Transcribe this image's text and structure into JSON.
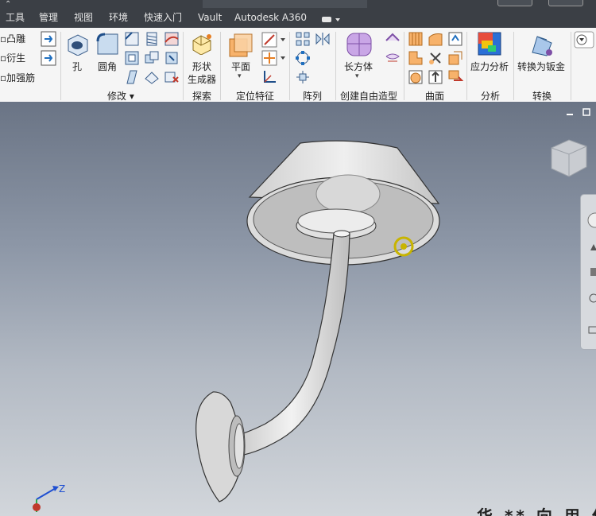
{
  "menu": {
    "tabs": [
      "工具",
      "管理",
      "视图",
      "环境",
      "快速入门",
      "Vault",
      "Autodesk A360"
    ]
  },
  "ribbon": {
    "left_items": [
      "凸雕",
      "衍生",
      "加强筋"
    ],
    "modify": {
      "hole": "孔",
      "fillet": "圆角",
      "label": "修改"
    },
    "explore": {
      "shape_gen_1": "形状",
      "shape_gen_2": "生成器",
      "label": "探索"
    },
    "work_features": {
      "plane": "平面",
      "label": "定位特征"
    },
    "pattern": {
      "label": "阵列"
    },
    "freeform": {
      "box": "长方体",
      "label": "创建自由造型"
    },
    "surface": {
      "label": "曲面"
    },
    "analysis": {
      "stress": "应力分析",
      "label": "分析"
    },
    "convert": {
      "to_sheet_metal": "转换为钣金",
      "label": "转换"
    }
  },
  "viewport": {
    "axis_z": "Z",
    "watermark": "华 ** 向 用 作"
  }
}
